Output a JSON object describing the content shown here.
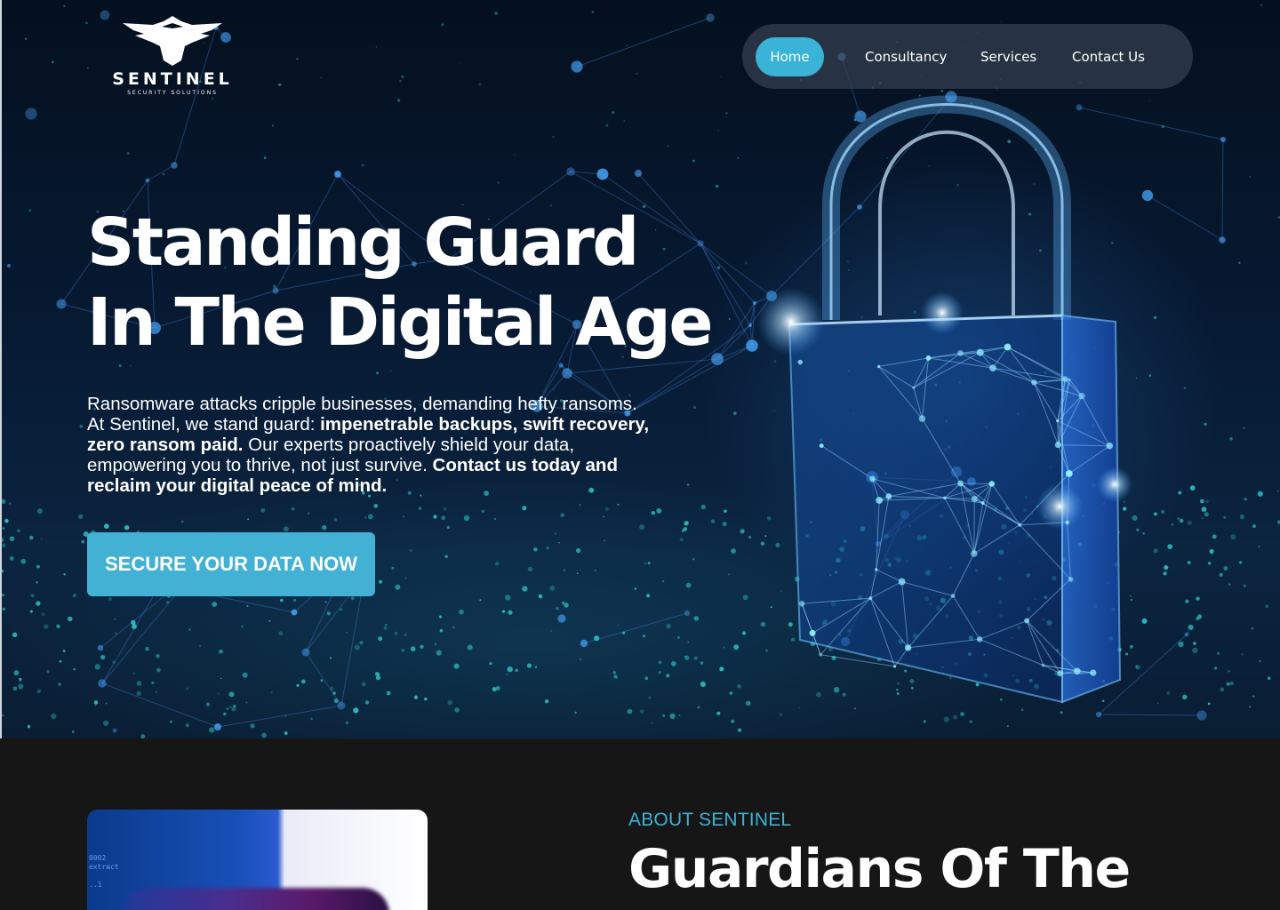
{
  "brand": {
    "name": "SENTINEL",
    "tagline": "SECURITY SOLUTIONS"
  },
  "nav": {
    "items": [
      {
        "label": "Home",
        "active": true
      },
      {
        "label": "Consultancy",
        "active": false
      },
      {
        "label": "Services",
        "active": false
      },
      {
        "label": "Contact Us",
        "active": false
      }
    ]
  },
  "hero": {
    "headline_line1": "Standing Guard",
    "headline_line2": "In The Digital Age",
    "intro_part1": "Ransomware attacks cripple businesses, demanding hefty ransoms. At Sentinel, we stand guard: ",
    "intro_bold1": "impenetrable backups, swift recovery, zero ransom paid.",
    "intro_part2": " Our experts proactively shield your data, empowering you to thrive, not just survive. ",
    "intro_bold2": "Contact us today and reclaim your digital peace of mind.",
    "cta_label": "SECURE YOUR DATA NOW"
  },
  "about": {
    "eyebrow": "ABOUT SENTINEL",
    "title": "Guardians Of The"
  },
  "colors": {
    "accent": "#3ab3d6",
    "cta": "#42b1d3",
    "hero_bg": "#071a33",
    "section_bg": "#161616",
    "text": "#ffffff"
  },
  "icons": {
    "logo": "eagle-icon",
    "hero_art": "padlock-network-illustration"
  }
}
